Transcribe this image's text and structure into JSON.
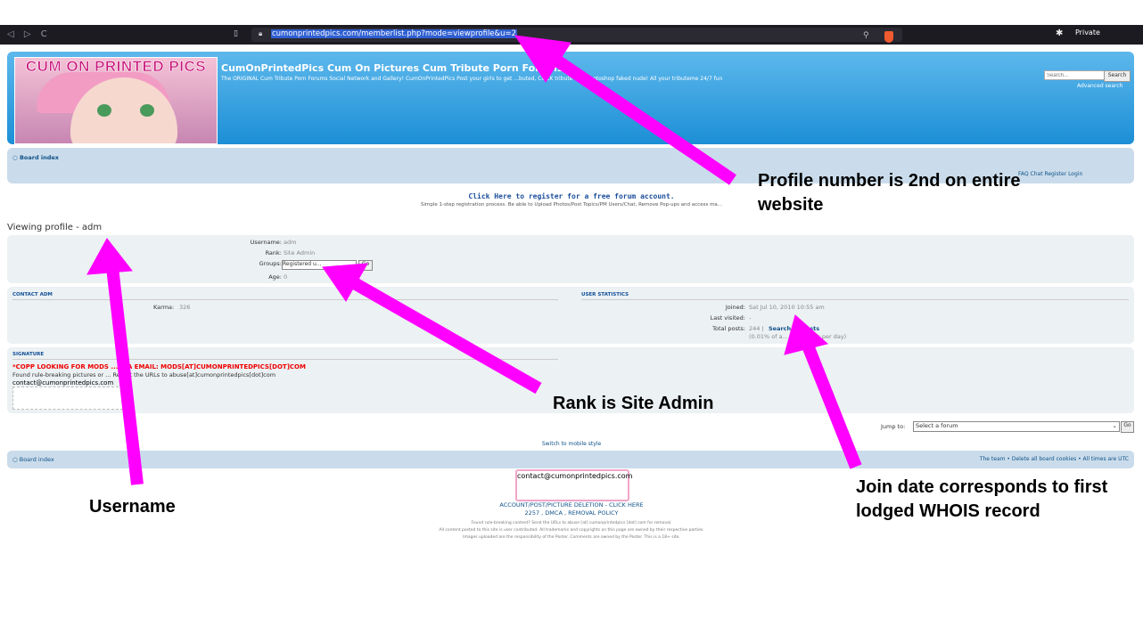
{
  "browser": {
    "url": "cumonprintedpics.com/memberlist.php?mode=viewprofile&u=2",
    "private_label": "Private",
    "nav_glyphs": "◁ ▷ C"
  },
  "header": {
    "logo_text": "CUM ON PRINTED PICS",
    "site_title": "CumOnPrintedPics Cum On Pictures Cum Tribute Porn Forums",
    "site_desc": "The ORIGINAL Cum Tribute Porn Forums Social Network and Gallery! CumOnPrintedPics Post your girls to get ...buted, COCK tribute and photoshop faked nude! All your tributeme 24/7 fun",
    "search_placeholder": "Search...",
    "search_button": "Search",
    "advanced_search": "Advanced search"
  },
  "navbar": {
    "board_index": "Board index",
    "links": "FAQ  Chat  Register  Login"
  },
  "register": {
    "link": "Click Here to register for a free forum account.",
    "sub": "Simple 1-step registration process. Be able to Upload Photos/Post Topics/PM Users/Chat, Remove Pop-ups and access ma..."
  },
  "profile": {
    "title": "Viewing profile - adm",
    "username_label": "Username:",
    "username": "adm",
    "rank_label": "Rank:",
    "rank": "Site Admin",
    "groups_label": "Groups:",
    "groups_selected": "Registered u...",
    "go_button": "Go",
    "age_label": "Age:",
    "age": "0"
  },
  "contact": {
    "heading": "CONTACT ADM",
    "karma_label": "Karma:",
    "karma": "326"
  },
  "stats": {
    "heading": "USER STATISTICS",
    "joined_label": "Joined:",
    "joined": "Sat Jul 10, 2010 10:55 am",
    "last_visited_label": "Last visited:",
    "last_visited": "-",
    "total_posts_label": "Total posts:",
    "total_posts": "244 |",
    "search_posts": "Search ... posts",
    "posts_detail": "(0.01% of a... 0.06 posts per day)"
  },
  "signature": {
    "heading": "SIGNATURE",
    "copp": "*COPP LOOKING FOR MODS ... VIA EMAIL: MODS[AT]CUMONPRINTEDPICS[DOT]COM",
    "text": "Found rule-breaking pictures or ... Report the URLs to abuse[at]cumonprintedpics[dot]com",
    "email": "contact@cumonprintedpics.com"
  },
  "jump": {
    "label": "Jump to:",
    "selected": "Select a forum",
    "go_button": "Go"
  },
  "mobile_style": "Switch to mobile style",
  "bottom_nav": {
    "board_index": "Board index",
    "links": "The team • Delete all board cookies • All times are UTC"
  },
  "footer": {
    "email": "contact@cumonprintedpics.com",
    "account_deletion": "ACCOUNT/POST/PICTURE DELETION - CLICK HERE",
    "dmca": "2257 , DMCA , REMOVAL POLICY",
    "small1": "Found rule-breaking content? Send the URLs to abuse [at] cumonprintedpics [dot] com for removal.",
    "small2": "All content posted to this site is user contributed. All trademarks and copyrights on this page are owned by their respective parties.",
    "small3": "Images uploaded are the responsibility of the Poster. Comments are owned by the Poster. This is a 18+ site."
  },
  "annotations": {
    "profile_number": "Profile number is 2nd on entire website",
    "rank": "Rank is Site Admin",
    "username": "Username",
    "join_date": "Join date corresponds to first lodged WHOIS record"
  },
  "colors": {
    "arrow": "#ff00ff",
    "header_blue": "#1c8fd6",
    "nav_bg": "#cadceb",
    "panel_bg": "#ecf1f3"
  }
}
